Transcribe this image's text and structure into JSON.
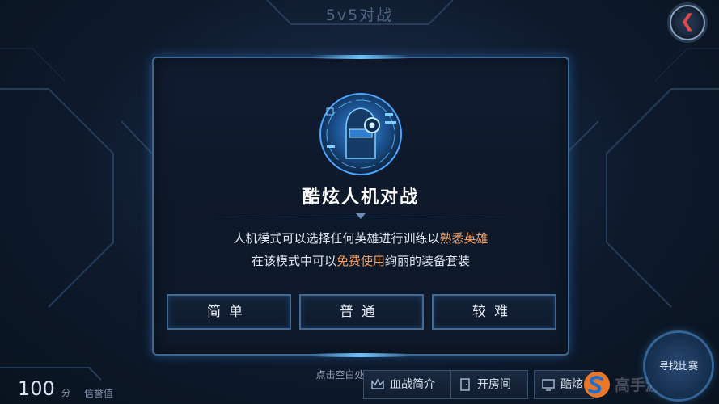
{
  "header": {
    "title": "5v5对战",
    "back_icon": "back-arrow-icon"
  },
  "dialog": {
    "emblem_icon": "robot-head-icon",
    "title": "酷炫人机对战",
    "desc_line1_prefix": "人机模式可以选择任何英雄进行训练以",
    "desc_line1_highlight": "熟悉英雄",
    "desc_line2_prefix": "在该模式中可以",
    "desc_line2_highlight": "免费使用",
    "desc_line2_suffix": "绚丽的装备套装",
    "highlight_color": "#f2a063",
    "buttons": {
      "easy": "简单",
      "normal": "普通",
      "hard": "较难"
    }
  },
  "hint": "点击空白处关闭界面",
  "score": {
    "value": "100",
    "unit": "分",
    "label": "信誉值"
  },
  "bottom_tabs": {
    "intro": "血战简介",
    "room": "开房间",
    "cool": "酷炫"
  },
  "match_button": "寻找比赛",
  "watermark": {
    "text": "高手游网",
    "logo_icon": "s-logo-icon"
  },
  "colors": {
    "accent_border": "#3d6793",
    "glow": "#6cc3ff",
    "back_arrow": "#e44a4a"
  }
}
